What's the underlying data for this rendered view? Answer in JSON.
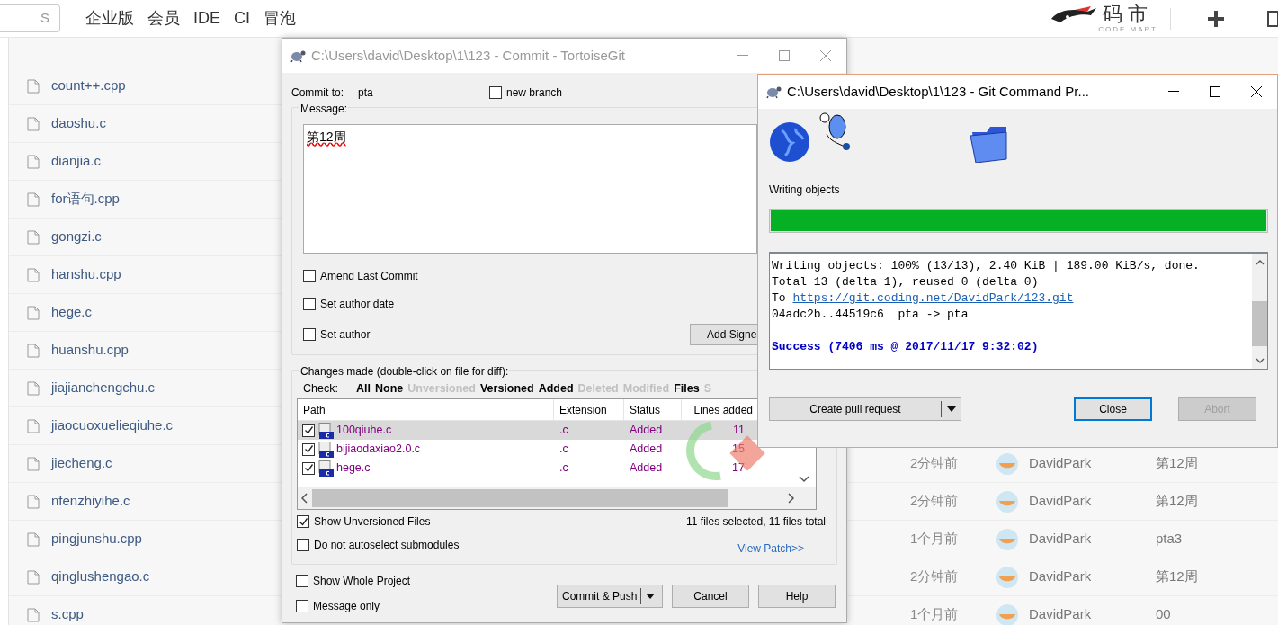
{
  "nav": {
    "search_hint": "S",
    "links": [
      "企业版",
      "会员",
      "IDE",
      "CI",
      "冒泡"
    ],
    "logo": {
      "name": "码市",
      "tagline": "CODE MART"
    }
  },
  "files": [
    {
      "name": "count++.cpp"
    },
    {
      "name": "daoshu.c"
    },
    {
      "name": "dianjia.c"
    },
    {
      "name": "for语句.cpp"
    },
    {
      "name": "gongzi.c"
    },
    {
      "name": "hanshu.cpp"
    },
    {
      "name": "hege.c"
    },
    {
      "name": "huanshu.cpp"
    },
    {
      "name": "jiajianchengchu.c"
    },
    {
      "name": "jiaocuoxuelieqiuhe.c"
    },
    {
      "name": "jiecheng.c",
      "time": "2分钟前",
      "author": "DavidPark",
      "message": "第12周"
    },
    {
      "name": "nfenzhiyihe.c",
      "time": "2分钟前",
      "author": "DavidPark",
      "message": "第12周"
    },
    {
      "name": "pingjunshu.cpp",
      "time": "1个月前",
      "author": "DavidPark",
      "message": "pta3"
    },
    {
      "name": "qinglushengao.c",
      "time": "2分钟前",
      "author": "DavidPark",
      "message": "第12周"
    },
    {
      "name": "s.cpp",
      "time": "1个月前",
      "author": "DavidPark",
      "message": "00"
    }
  ],
  "commit_window": {
    "title": "C:\\Users\\david\\Desktop\\1\\123 - Commit - TortoiseGit",
    "commit_to_label": "Commit to:",
    "branch": "pta",
    "new_branch": {
      "label": "new branch",
      "checked": false
    },
    "message_label": "Message:",
    "message": "第12周",
    "options": [
      {
        "label": "Amend Last Commit",
        "checked": false
      },
      {
        "label": "Set author date",
        "checked": false
      },
      {
        "label": "Set author",
        "checked": false
      }
    ],
    "signoff_button": "Add Signe",
    "changes_label": "Changes made (double-click on file for diff):",
    "check_label": "Check:",
    "check_filters": [
      {
        "label": "All",
        "disabled": false
      },
      {
        "label": "None",
        "disabled": false
      },
      {
        "label": "Unversioned",
        "disabled": true
      },
      {
        "label": "Versioned",
        "disabled": false
      },
      {
        "label": "Added",
        "disabled": false
      },
      {
        "label": "Deleted",
        "disabled": true
      },
      {
        "label": "Modified",
        "disabled": true
      },
      {
        "label": "Files",
        "disabled": false
      },
      {
        "label": "S",
        "disabled": true
      }
    ],
    "columns": [
      "Path",
      "Extension",
      "Status",
      "Lines added"
    ],
    "rows": [
      {
        "path": "100qiuhe.c",
        "extension": ".c",
        "status": "Added",
        "lines_added": "11",
        "checked": true,
        "selected": true
      },
      {
        "path": "bijiaodaxiao2.0.c",
        "extension": ".c",
        "status": "Added",
        "lines_added": "15",
        "checked": true,
        "selected": false
      },
      {
        "path": "hege.c",
        "extension": ".c",
        "status": "Added",
        "lines_added": "17",
        "checked": true,
        "selected": false
      }
    ],
    "list_options": [
      {
        "label": "Show Unversioned Files",
        "checked": true
      },
      {
        "label": "Do not autoselect submodules",
        "checked": false
      }
    ],
    "summary": "11 files selected, 11 files total",
    "view_patch": "View Patch>>",
    "bottom_options": [
      {
        "label": "Show Whole Project",
        "checked": false
      },
      {
        "label": "Message only",
        "checked": false
      }
    ],
    "buttons": [
      {
        "label": "Commit & Push",
        "kind": "split"
      },
      {
        "label": "Cancel",
        "kind": "plain"
      },
      {
        "label": "Help",
        "kind": "plain"
      }
    ]
  },
  "progress_window": {
    "title": "C:\\Users\\david\\Desktop\\1\\123 - Git Command Pr...",
    "stage": "Writing objects",
    "progress": {
      "level": 1
    },
    "log": [
      {
        "kind": "plain",
        "text": "Writing objects: 100% (13/13), 2.40 KiB | 189.00 KiB/s, done."
      },
      {
        "kind": "plain",
        "text": "Total 13 (delta 1), reused 0 (delta 0)"
      },
      {
        "kind": "link",
        "text": "To",
        "url": "https://git.coding.net/DavidPark/123.git"
      },
      {
        "kind": "plain",
        "text": "04adc2b..44519c6  pta -> pta"
      },
      {
        "kind": "blank"
      },
      {
        "kind": "success",
        "text": "Success (7406 ms @ 2017/11/17 9:32:02)"
      }
    ],
    "buttons": [
      {
        "label": "Create pull request",
        "kind": "split",
        "focused": false,
        "disabled": false
      },
      {
        "label": "Close",
        "kind": "plain",
        "focused": true,
        "disabled": false
      },
      {
        "label": "Abort",
        "kind": "plain",
        "focused": false,
        "disabled": true
      }
    ]
  }
}
